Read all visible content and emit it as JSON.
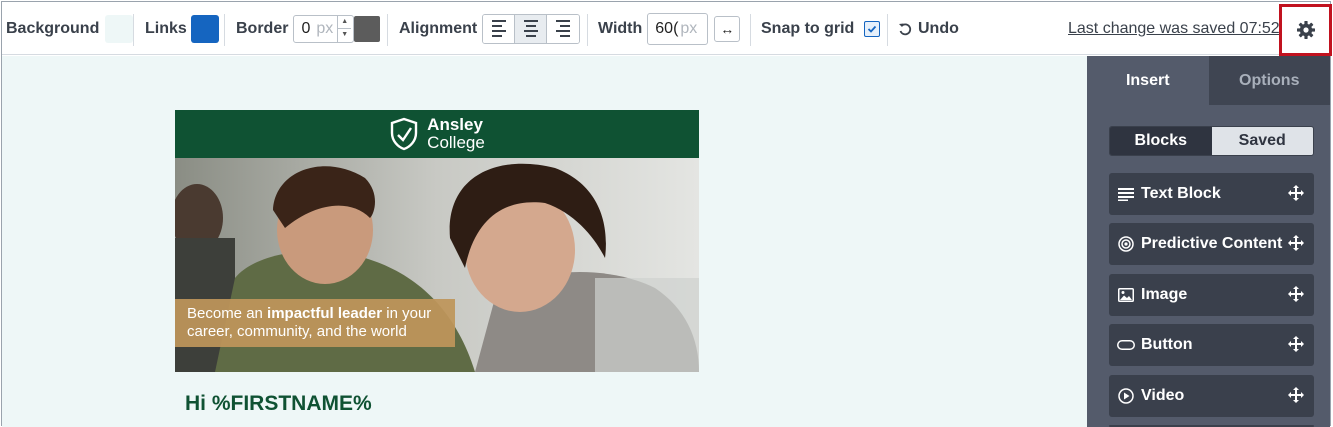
{
  "toolbar": {
    "background_label": "Background",
    "links_label": "Links",
    "border_label": "Border",
    "border_value": "0",
    "border_unit": "px",
    "alignment_label": "Alignment",
    "alignment_selected": "center",
    "width_label": "Width",
    "width_value": "60(",
    "width_unit": "px",
    "snap_label": "Snap to grid",
    "snap_checked": true,
    "undo_label": "Undo",
    "saved_text": "Last change was saved 07:52",
    "colors": {
      "background": "#eef7f7",
      "links": "#1565c0",
      "border": "#5c5c5c"
    }
  },
  "email": {
    "brand_line1": "Ansley",
    "brand_line2": "College",
    "hero_caption_pre": "Become an ",
    "hero_caption_bold": "impactful leader",
    "hero_caption_post": " in your career, community, and the world",
    "greeting": "Hi %FIRSTNAME%",
    "colors": {
      "brand": "#0f5233",
      "caption_bg": "#be965a"
    }
  },
  "panel": {
    "tabs": [
      {
        "label": "Insert",
        "active": true
      },
      {
        "label": "Options",
        "active": false
      }
    ],
    "segments": [
      {
        "label": "Blocks",
        "active": true
      },
      {
        "label": "Saved",
        "active": false
      }
    ],
    "blocks": [
      {
        "label": "Text Block",
        "icon": "text-lines-icon"
      },
      {
        "label": "Predictive Content",
        "icon": "target-icon"
      },
      {
        "label": "Image",
        "icon": "image-icon"
      },
      {
        "label": "Button",
        "icon": "button-pill-icon"
      },
      {
        "label": "Video",
        "icon": "play-circle-icon"
      }
    ]
  }
}
